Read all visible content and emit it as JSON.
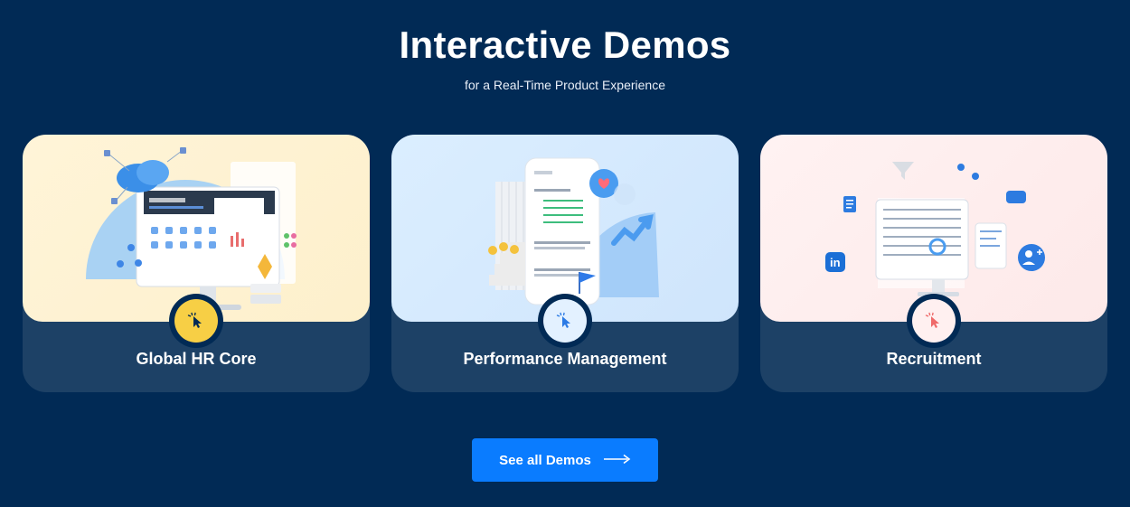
{
  "header": {
    "title": "Interactive Demos",
    "subtitle": "for a Real-Time Product Experience"
  },
  "cards": [
    {
      "label": "Global HR Core",
      "badge_icon": "cursor-click-icon",
      "badge_color": "#f7cf45",
      "theme": "#fff4d8"
    },
    {
      "label": "Performance Management",
      "badge_icon": "cursor-click-icon",
      "badge_color": "#e3f1ff",
      "theme": "#dbeeff"
    },
    {
      "label": "Recruitment",
      "badge_icon": "cursor-click-icon",
      "badge_color": "#fff0f0",
      "theme": "#fff2f2"
    }
  ],
  "cta": {
    "label": "See all Demos",
    "icon": "arrow-right-icon"
  },
  "colors": {
    "background": "#012a55",
    "card_footer": "#1d4166",
    "accent": "#0a7cff"
  }
}
